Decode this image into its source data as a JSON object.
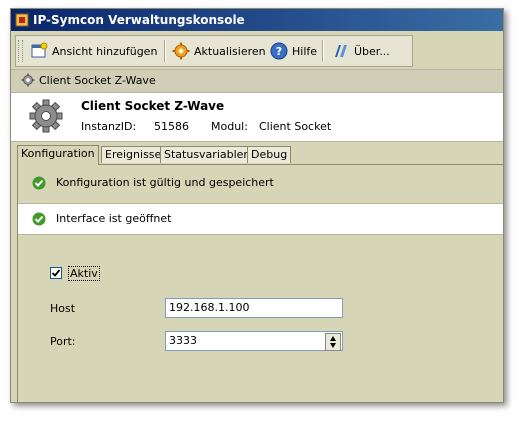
{
  "window": {
    "title": "IP-Symcon Verwaltungskonsole"
  },
  "toolbar": {
    "add_view": "Ansicht hinzufügen",
    "refresh": "Aktualisieren",
    "help": "Hilfe",
    "about": "Über..."
  },
  "breadcrumb": {
    "label": "Client Socket Z-Wave"
  },
  "instance": {
    "name": "Client Socket Z-Wave",
    "id_label": "InstanzID:",
    "id_value": "51586",
    "module_label": "Modul:",
    "module_value": "Client Socket"
  },
  "tabs": [
    "Konfiguration",
    "Ereignisse",
    "Statusvariablen",
    "Debug"
  ],
  "status": {
    "config": "Konfiguration ist gültig und gespeichert",
    "interface": "Interface ist geöffnet"
  },
  "form": {
    "active_label": "Aktiv",
    "active_checked": true,
    "host_label": "Host",
    "host_value": "192.168.1.100",
    "port_label": "Port:",
    "port_value": "3333"
  },
  "colors": {
    "panel": "#d6d6b7",
    "titlebar": "#0a246a",
    "ok_green": "#3f9a2a"
  }
}
